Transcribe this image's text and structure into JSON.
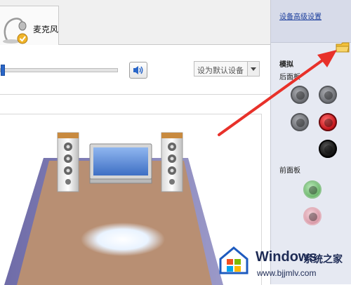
{
  "tabs": [
    {
      "label": "麦克风",
      "icon": "microphone-icon"
    }
  ],
  "volume": {
    "level": 0.0,
    "mute_icon": "speaker-volume-icon"
  },
  "default_device": {
    "label": "设为默认设备",
    "icon": "dropdown-arrow-icon"
  },
  "right_panel": {
    "settings_link": "设备高级设置",
    "analog_title": "模拟",
    "rear_panel_title": "后面板",
    "front_panel_title": "前面板",
    "rear_jacks": [
      {
        "color": "#8a8c91",
        "state": "gray"
      },
      {
        "color": "#8a8c91",
        "state": "gray"
      },
      {
        "color": "#8a8c91",
        "state": "gray"
      },
      {
        "color": "#e0262c",
        "state": "red"
      },
      {
        "color": "#111111",
        "state": "black"
      }
    ],
    "front_jacks": [
      {
        "color": "#8fd18f",
        "state": "green"
      },
      {
        "color": "#e8b8c2",
        "state": "pink"
      }
    ],
    "folder_icon": "folder-icon"
  },
  "scene": {
    "description_icons": [
      "left-speaker-icon",
      "tv-icon",
      "right-speaker-icon"
    ]
  },
  "watermark": {
    "brand": "Windows",
    "sub": "系统之家",
    "url": "www.bjjmlv.com"
  },
  "annotation": {
    "arrow_color": "#e8312a"
  }
}
